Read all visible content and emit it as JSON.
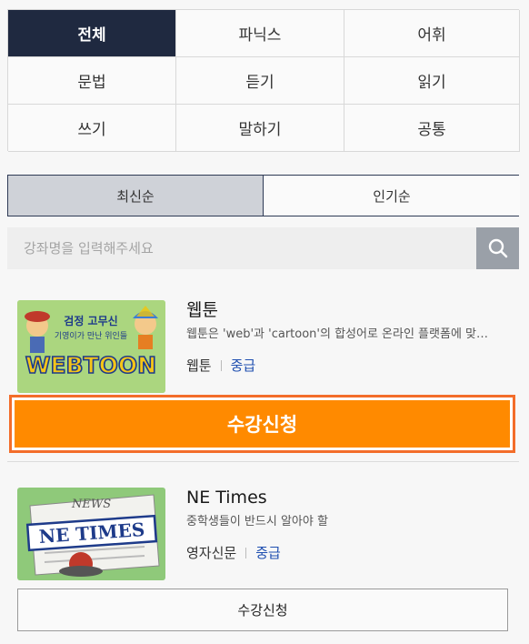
{
  "categories": [
    "전체",
    "파닉스",
    "어휘",
    "문법",
    "듣기",
    "읽기",
    "쓰기",
    "말하기",
    "공통"
  ],
  "sort": {
    "latest": "최신순",
    "popular": "인기순"
  },
  "search": {
    "placeholder": "강좌명을 입력해주세요"
  },
  "courses": [
    {
      "title": "웹툰",
      "description": "웹툰은 'web'과 'cartoon'의 합성어로 온라인 플랫폼에 맞…",
      "category": "웹툰",
      "level": "중급",
      "enroll_label": "수강신청",
      "thumbnail": {
        "top_text": "검정 고무신",
        "sub_text": "기영이가 만난 위인들",
        "logo": "WEBTOON"
      }
    },
    {
      "title": "NE Times",
      "description": "중학생들이 반드시 알아야 할",
      "category": "영자신문",
      "level": "중급",
      "enroll_label": "수강신청",
      "thumbnail": {
        "top_text": "NEWS",
        "logo": "NE TIMES"
      }
    }
  ],
  "colors": {
    "active_tab": "#1f2940",
    "accent_orange": "#ff8a00",
    "level_blue": "#1f4fb0"
  }
}
